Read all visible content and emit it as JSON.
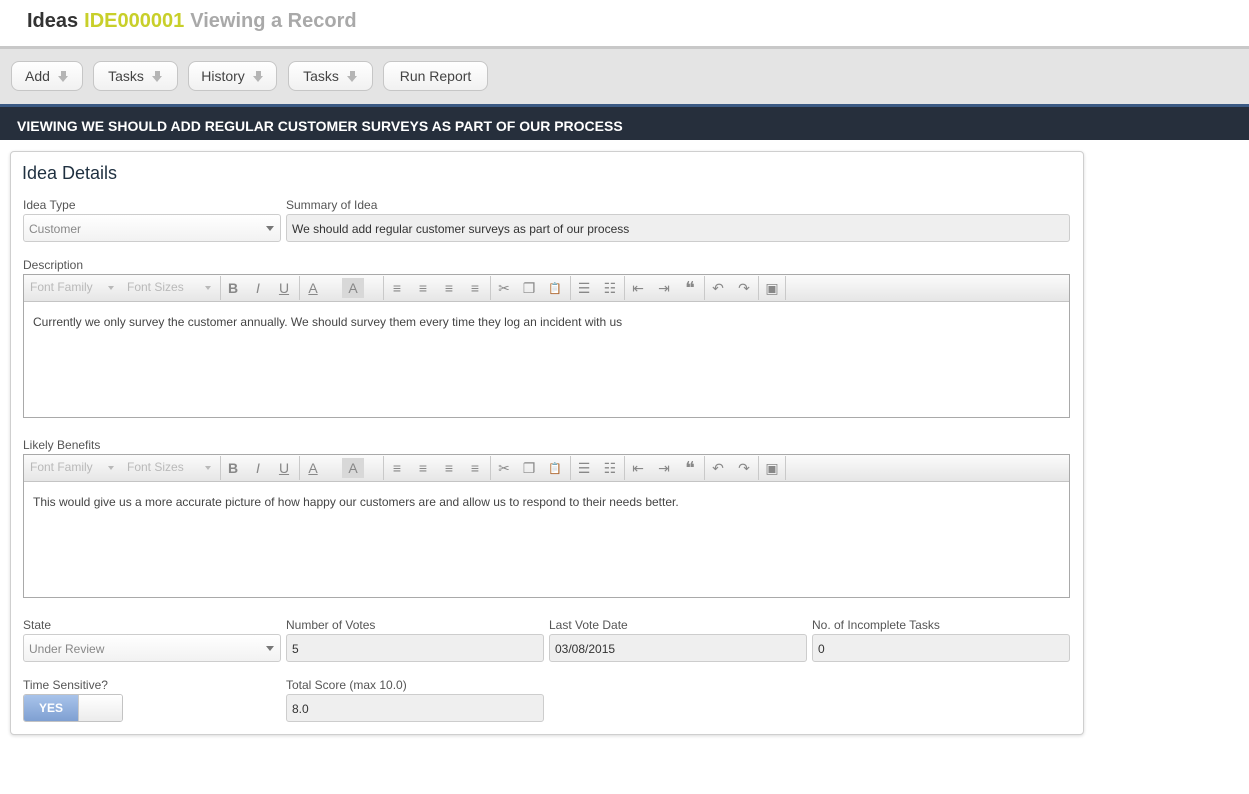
{
  "header": {
    "module": "Ideas",
    "record_id": "IDE000001",
    "mode": "Viewing a Record"
  },
  "toolbar": {
    "buttons": [
      {
        "label": "Add",
        "has_dropdown": true
      },
      {
        "label": "Tasks",
        "has_dropdown": true
      },
      {
        "label": "History",
        "has_dropdown": true
      },
      {
        "label": "Tasks",
        "has_dropdown": true
      },
      {
        "label": "Run Report",
        "has_dropdown": false
      }
    ]
  },
  "banner": {
    "text": "VIEWING WE SHOULD ADD REGULAR CUSTOMER SURVEYS AS PART OF OUR PROCESS"
  },
  "panel": {
    "title": "Idea Details"
  },
  "form": {
    "idea_type": {
      "label": "Idea Type",
      "value": "Customer"
    },
    "summary": {
      "label": "Summary of Idea",
      "value": "We should add regular customer surveys as part of our process"
    },
    "description": {
      "label": "Description",
      "value": "Currently we only survey the customer annually. We should survey them every time they log an incident with us"
    },
    "benefits": {
      "label": "Likely Benefits",
      "value": "This would give us a more accurate picture of how happy our customers are and allow us to respond to their needs better."
    },
    "state": {
      "label": "State",
      "value": "Under Review"
    },
    "votes": {
      "label": "Number of Votes",
      "value": "5"
    },
    "last_vote": {
      "label": "Last Vote Date",
      "value": "03/08/2015"
    },
    "incomplete_tasks": {
      "label": "No. of Incomplete Tasks",
      "value": "0"
    },
    "time_sensitive": {
      "label": "Time Sensitive?",
      "value": "YES"
    },
    "total_score": {
      "label": "Total Score (max 10.0)",
      "value": "8.0"
    }
  },
  "editor_toolbar": {
    "font_family": "Font Family",
    "font_sizes": "Font Sizes",
    "buttons": [
      {
        "name": "bold-icon",
        "glyph": "B"
      },
      {
        "name": "italic-icon",
        "glyph": "I"
      },
      {
        "name": "underline-icon",
        "glyph": "U"
      },
      {
        "name": "text-color-icon",
        "glyph": "A"
      },
      {
        "name": "background-color-icon",
        "glyph": "A"
      },
      {
        "name": "align-left-icon",
        "glyph": "≡"
      },
      {
        "name": "align-center-icon",
        "glyph": "≡"
      },
      {
        "name": "align-right-icon",
        "glyph": "≡"
      },
      {
        "name": "align-justify-icon",
        "glyph": "≡"
      },
      {
        "name": "cut-icon",
        "glyph": "✂"
      },
      {
        "name": "copy-icon",
        "glyph": "❐"
      },
      {
        "name": "paste-icon",
        "glyph": "📋"
      },
      {
        "name": "bullet-list-icon",
        "glyph": "☰"
      },
      {
        "name": "numbered-list-icon",
        "glyph": "☷"
      },
      {
        "name": "outdent-icon",
        "glyph": "⇤"
      },
      {
        "name": "indent-icon",
        "glyph": "⇥"
      },
      {
        "name": "blockquote-icon",
        "glyph": "❝"
      },
      {
        "name": "undo-icon",
        "glyph": "↶"
      },
      {
        "name": "redo-icon",
        "glyph": "↷"
      },
      {
        "name": "image-icon",
        "glyph": "▣"
      }
    ]
  },
  "colors": {
    "record_id": "#c8cf2a",
    "banner_bg": "#262f3c",
    "toggle_on": "#8aa9d8"
  }
}
